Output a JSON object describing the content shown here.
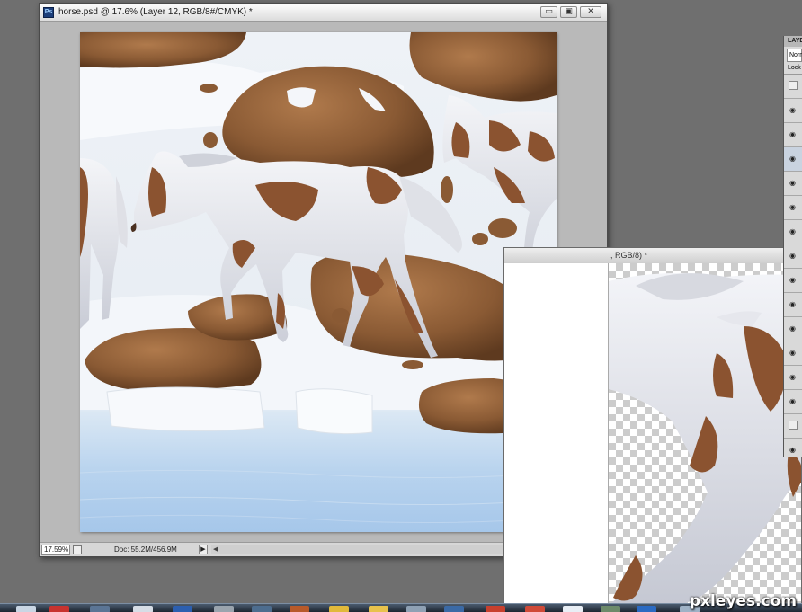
{
  "main_window": {
    "title": "horse.psd @ 17.6% (Layer 12, RGB/8#/CMYK) *",
    "app_icon": "Ps",
    "controls": {
      "minimize": "▭",
      "restore": "▣",
      "close": "✕"
    },
    "status": {
      "zoom": "17.59%",
      "doc_size": "Doc: 55.2M/456.9M",
      "arrow": "▶"
    }
  },
  "second_window": {
    "title": ", RGB/8) *"
  },
  "layers_panel": {
    "header": "LAYE",
    "blend_mode": "Norm",
    "lock_label": "Lock",
    "rows": [
      {
        "visible": false
      },
      {
        "visible": true,
        "icon": "eye-icon"
      },
      {
        "visible": true,
        "icon": "eye-icon"
      },
      {
        "visible": true,
        "icon": "eye-icon",
        "selected": true
      },
      {
        "visible": true,
        "icon": "eye-icon"
      },
      {
        "visible": true,
        "icon": "eye-icon"
      },
      {
        "visible": true,
        "icon": "eye-icon"
      },
      {
        "visible": true,
        "icon": "eye-icon"
      },
      {
        "visible": true,
        "icon": "eye-icon"
      },
      {
        "visible": true,
        "icon": "eye-icon"
      },
      {
        "visible": true,
        "icon": "eye-icon"
      },
      {
        "visible": true,
        "icon": "eye-icon"
      },
      {
        "visible": true,
        "icon": "eye-icon"
      },
      {
        "visible": true,
        "icon": "eye-icon"
      },
      {
        "visible": false
      },
      {
        "visible": true,
        "icon": "eye-icon"
      }
    ],
    "eye_glyph": "◉"
  },
  "watermark": "pxleyes.com",
  "colors": {
    "workspace": "#6f6f6f",
    "snow": "#eef2f7",
    "water": "#a6c7ea",
    "rock": "#8a5a34",
    "horse_white": "#e9eaef",
    "horse_patch": "#8b5330"
  }
}
